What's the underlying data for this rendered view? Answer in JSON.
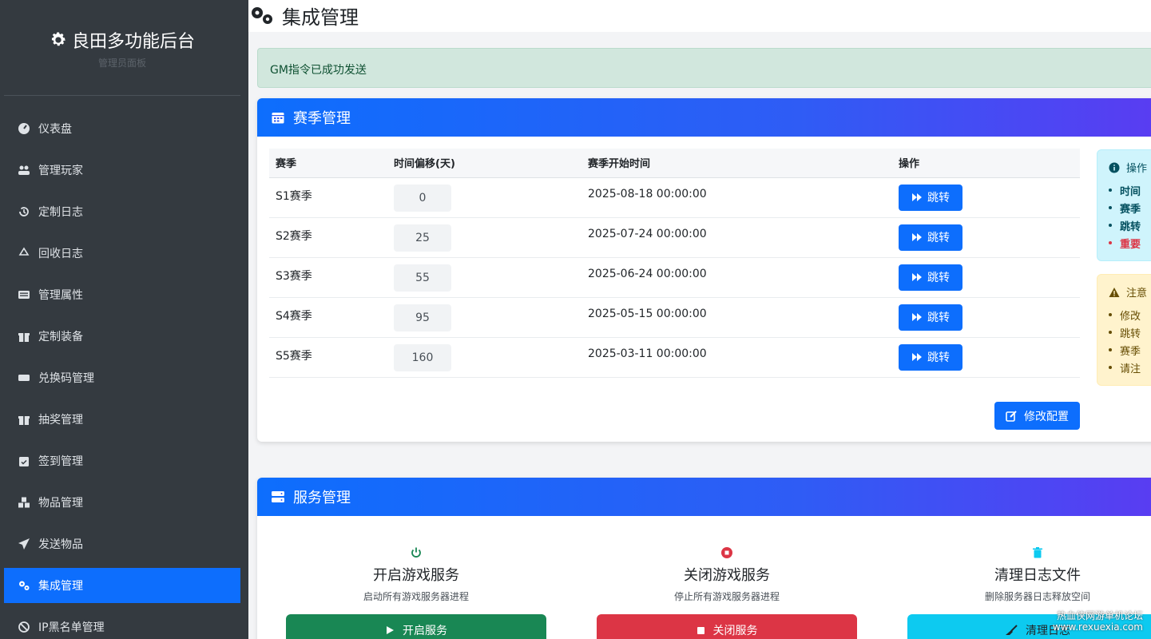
{
  "sidebar": {
    "brand_title": "良田多功能后台",
    "brand_subtitle": "管理员面板",
    "items": [
      {
        "label": "仪表盘",
        "icon": "dashboard-icon"
      },
      {
        "label": "管理玩家",
        "icon": "users-icon"
      },
      {
        "label": "定制日志",
        "icon": "history-icon"
      },
      {
        "label": "回收日志",
        "icon": "recycle-icon"
      },
      {
        "label": "管理属性",
        "icon": "list-icon"
      },
      {
        "label": "定制装备",
        "icon": "gift-icon"
      },
      {
        "label": "兑换码管理",
        "icon": "ticket-icon"
      },
      {
        "label": "抽奖管理",
        "icon": "gift-icon"
      },
      {
        "label": "签到管理",
        "icon": "calendar-check-icon"
      },
      {
        "label": "物品管理",
        "icon": "boxes-icon"
      },
      {
        "label": "发送物品",
        "icon": "paper-plane-icon"
      },
      {
        "label": "集成管理",
        "icon": "cogs-icon",
        "active": true
      },
      {
        "label": "IP黑名单管理",
        "icon": "ban-icon"
      }
    ]
  },
  "page": {
    "title": "集成管理"
  },
  "alert": {
    "text": "GM指令已成功发送"
  },
  "season": {
    "header": "赛季管理",
    "columns": [
      "赛季",
      "时间偏移(天)",
      "赛季开始时间",
      "操作"
    ],
    "rows": [
      {
        "name": "S1赛季",
        "offset": "0",
        "start": "2025-08-18 00:00:00",
        "action": "跳转"
      },
      {
        "name": "S2赛季",
        "offset": "25",
        "start": "2025-07-24 00:00:00",
        "action": "跳转"
      },
      {
        "name": "S3赛季",
        "offset": "55",
        "start": "2025-06-24 00:00:00",
        "action": "跳转"
      },
      {
        "name": "S4赛季",
        "offset": "95",
        "start": "2025-05-15 00:00:00",
        "action": "跳转"
      },
      {
        "name": "S5赛季",
        "offset": "160",
        "start": "2025-03-11 00:00:00",
        "action": "跳转"
      }
    ],
    "modify_label": "修改配置",
    "info": {
      "title": "操作",
      "items": [
        "时间",
        "赛季",
        "跳转",
        "重要"
      ]
    },
    "warn": {
      "title": "注意",
      "items": [
        "修改",
        "跳转",
        "赛季",
        "请注"
      ]
    }
  },
  "service": {
    "header": "服务管理",
    "cards": [
      {
        "title": "开启游戏服务",
        "desc": "启动所有游戏服务器进程",
        "button": "开启服务",
        "icon": "power-icon"
      },
      {
        "title": "关闭游戏服务",
        "desc": "停止所有游戏服务器进程",
        "button": "关闭服务",
        "icon": "stop-circle-icon"
      },
      {
        "title": "清理日志文件",
        "desc": "删除服务器日志释放空间",
        "button": "清理日志",
        "icon": "trash-icon"
      }
    ]
  },
  "watermark": {
    "line1": "热血侠网游单机论坛",
    "line2": "www.rexuexia.com"
  },
  "colors": {
    "primary": "#0d6efd",
    "sidebar": "#343a40",
    "success": "#198754",
    "danger": "#dc3545",
    "info": "#0dcaf0"
  }
}
